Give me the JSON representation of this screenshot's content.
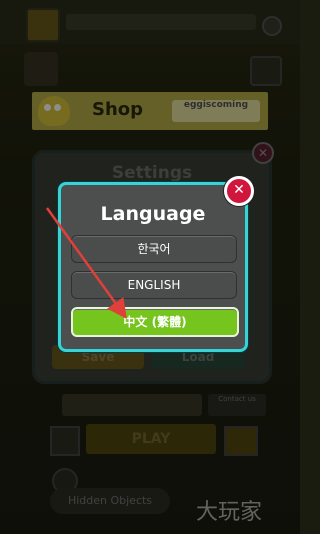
{
  "background": {
    "shop_banner": {
      "label": "Shop",
      "promo": "eggiscoming"
    },
    "settings": {
      "title": "Settings",
      "save": "Save",
      "load": "Load"
    },
    "contact": "Contact us",
    "play": "PLAY",
    "hidden_objects": "Hidden Objects",
    "watermark": "大玩家"
  },
  "language_dialog": {
    "title": "Language",
    "options": [
      "한국어",
      "ENGLISH",
      "中文 (繁體)"
    ],
    "selected_index": 2,
    "close_symbol": "✕"
  },
  "settings_close_symbol": "✕",
  "colors": {
    "dialog_border": "#36d3d7",
    "selected_option": "#76c41e",
    "close_button": "#d0163c",
    "arrow": "#e0403a"
  }
}
